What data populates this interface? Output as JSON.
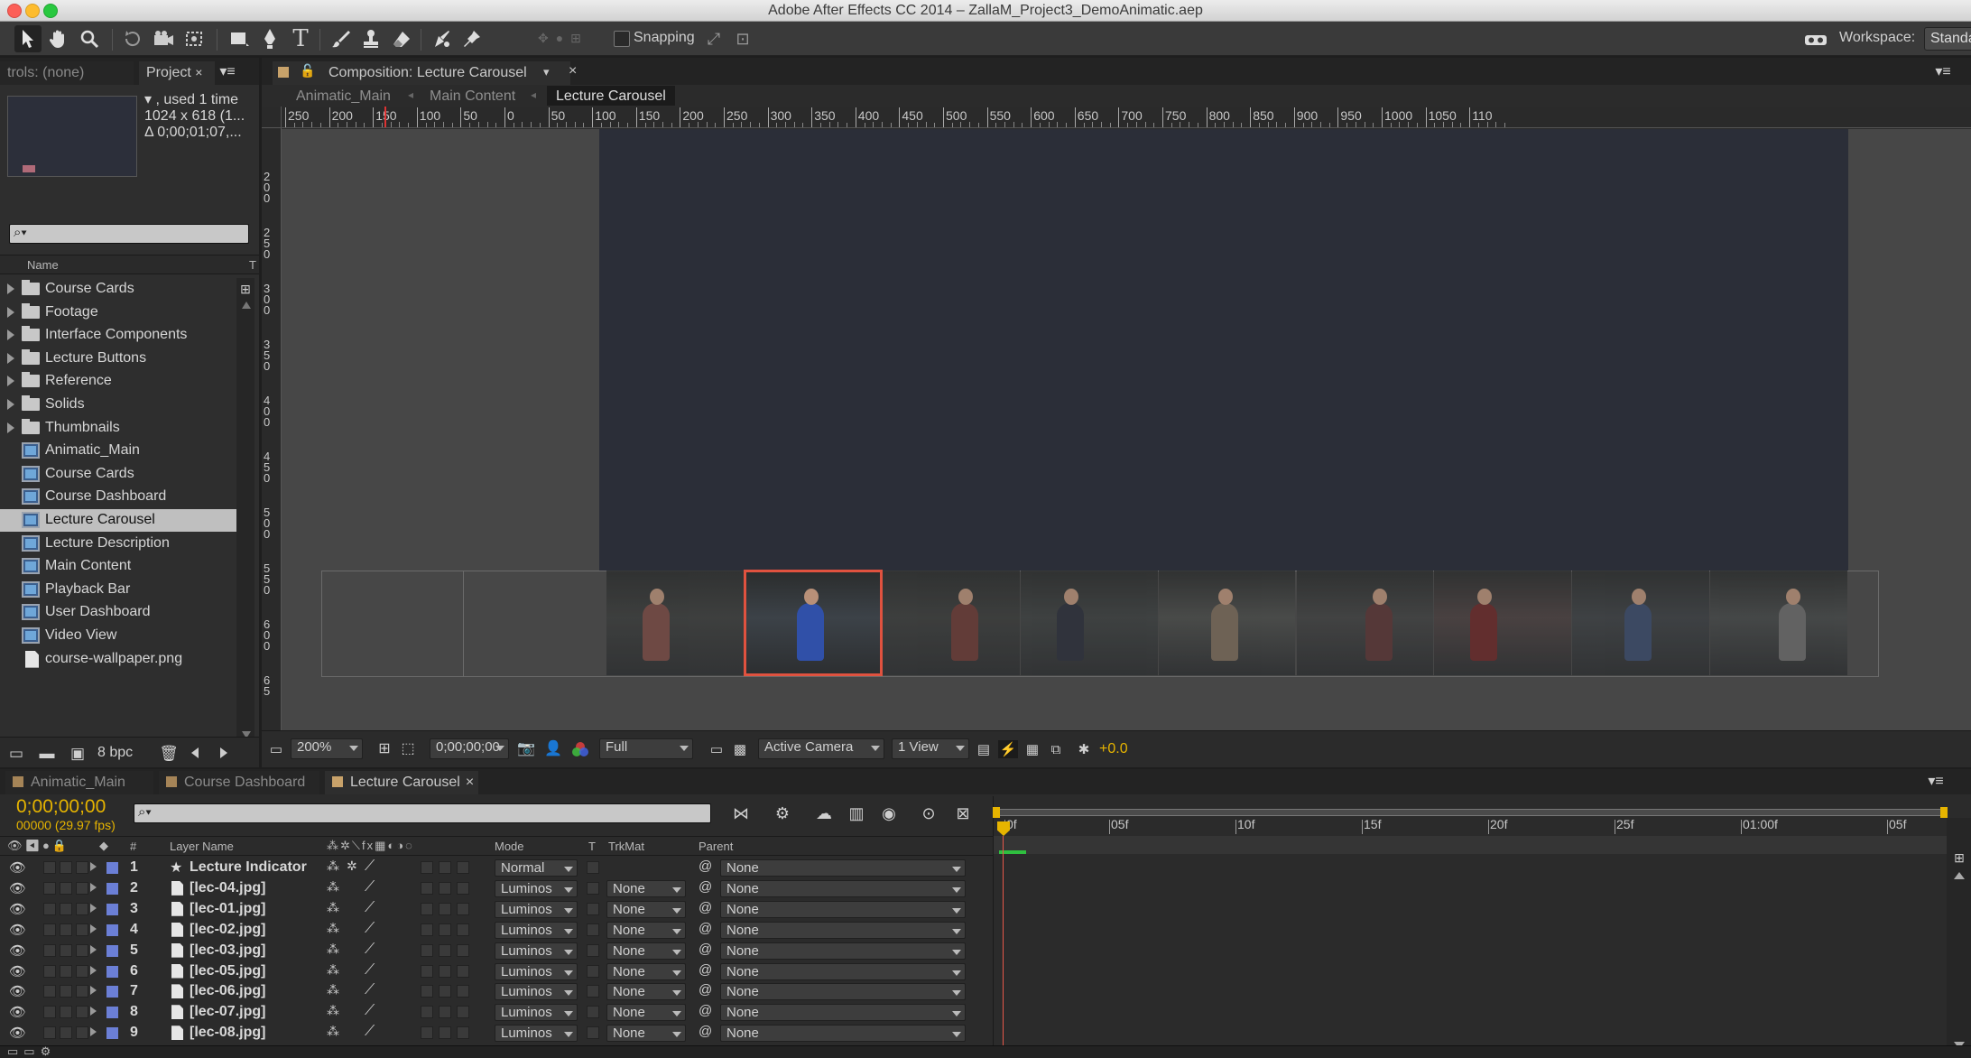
{
  "window": {
    "title": "Adobe After Effects CC 2014 – ZallaM_Project3_DemoAnimatic.aep"
  },
  "toolbar": {
    "snapping_label": "Snapping",
    "workspace_label": "Workspace:",
    "workspace_value": "Standa"
  },
  "left_panel": {
    "effects_tab": "trols: (none)",
    "project_tab": "Project",
    "info_used": "▾ , used 1 time",
    "info_size": "1024 x 618 (1...",
    "info_duration": "Δ 0;00;01;07,...",
    "search_placeholder": "",
    "col_name": "Name",
    "col_type": "T",
    "items": [
      {
        "label": "Course Cards",
        "kind": "folder"
      },
      {
        "label": "Footage",
        "kind": "folder"
      },
      {
        "label": "Interface Components",
        "kind": "folder"
      },
      {
        "label": "Lecture Buttons",
        "kind": "folder"
      },
      {
        "label": "Reference",
        "kind": "folder"
      },
      {
        "label": "Solids",
        "kind": "folder"
      },
      {
        "label": "Thumbnails",
        "kind": "folder"
      },
      {
        "label": "Animatic_Main",
        "kind": "comp"
      },
      {
        "label": "Course Cards",
        "kind": "comp"
      },
      {
        "label": "Course Dashboard",
        "kind": "comp"
      },
      {
        "label": "Lecture Carousel",
        "kind": "comp",
        "selected": true
      },
      {
        "label": "Lecture Description",
        "kind": "comp"
      },
      {
        "label": "Main Content",
        "kind": "comp"
      },
      {
        "label": "Playback Bar",
        "kind": "comp"
      },
      {
        "label": "User Dashboard",
        "kind": "comp"
      },
      {
        "label": "Video View",
        "kind": "comp"
      },
      {
        "label": "course-wallpaper.png",
        "kind": "file"
      }
    ],
    "bpc": "8 bpc"
  },
  "composition": {
    "tab_label": "Composition: Lecture Carousel",
    "breadcrumbs": [
      "Animatic_Main",
      "Main Content",
      "Lecture Carousel"
    ],
    "ruler_h": [
      "250",
      "200",
      "150",
      "100",
      "50",
      "0",
      "50",
      "100",
      "150",
      "200",
      "250",
      "300",
      "350",
      "400",
      "450",
      "500",
      "550",
      "600",
      "650",
      "700",
      "750",
      "800",
      "850",
      "900",
      "950",
      "1000",
      "1050",
      "110"
    ],
    "ruler_v": [
      "2 0 0",
      "2 5 0",
      "3 0 0",
      "3 5 0",
      "4 0 0",
      "4 5 0",
      "5 0 0",
      "5 5 0",
      "6 0 0",
      "6 5"
    ],
    "zoom": "200%",
    "timecode": "0;00;00;00",
    "resolution": "Full",
    "camera": "Active Camera",
    "views": "1 View",
    "exposure": "+0.0"
  },
  "timeline": {
    "tabs": [
      "Animatic_Main",
      "Course Dashboard",
      "Lecture Carousel"
    ],
    "timecode": "0;00;00;00",
    "frames": "00000 (29.97 fps)",
    "col_num": "#",
    "col_layer": "Layer Name",
    "col_mode": "Mode",
    "col_t": "T",
    "col_trkmat": "TrkMat",
    "col_parent": "Parent",
    "time_labels": [
      "0f",
      "05f",
      "10f",
      "15f",
      "20f",
      "25f",
      "01:00f",
      "05f"
    ],
    "layers": [
      {
        "num": "1",
        "name": "Lecture Indicator",
        "kind": "star",
        "mode": "Normal",
        "trkmat": "",
        "parent": "None"
      },
      {
        "num": "2",
        "name": "[lec-04.jpg]",
        "kind": "file",
        "mode": "Luminos",
        "trkmat": "None",
        "parent": "None"
      },
      {
        "num": "3",
        "name": "[lec-01.jpg]",
        "kind": "file",
        "mode": "Luminos",
        "trkmat": "None",
        "parent": "None"
      },
      {
        "num": "4",
        "name": "[lec-02.jpg]",
        "kind": "file",
        "mode": "Luminos",
        "trkmat": "None",
        "parent": "None"
      },
      {
        "num": "5",
        "name": "[lec-03.jpg]",
        "kind": "file",
        "mode": "Luminos",
        "trkmat": "None",
        "parent": "None"
      },
      {
        "num": "6",
        "name": "[lec-05.jpg]",
        "kind": "file",
        "mode": "Luminos",
        "trkmat": "None",
        "parent": "None"
      },
      {
        "num": "7",
        "name": "[lec-06.jpg]",
        "kind": "file",
        "mode": "Luminos",
        "trkmat": "None",
        "parent": "None"
      },
      {
        "num": "8",
        "name": "[lec-07.jpg]",
        "kind": "file",
        "mode": "Luminos",
        "trkmat": "None",
        "parent": "None"
      },
      {
        "num": "9",
        "name": "[lec-08.jpg]",
        "kind": "file",
        "mode": "Luminos",
        "trkmat": "None",
        "parent": "None"
      }
    ]
  },
  "colors": {
    "accent_timecode": "#e6b400",
    "layer_label": "#6b7fd6",
    "selection": "#e0523f",
    "comp_bg": "#2b2e38",
    "track_bar": "#8a8ab6",
    "first_layer_bar": "#3147a8"
  },
  "icons": [
    "selection-tool-icon",
    "hand-tool-icon",
    "zoom-tool-icon",
    "rotate-tool-icon",
    "camera-tool-icon",
    "pan-behind-icon",
    "rectangle-tool-icon",
    "pen-tool-icon",
    "type-tool-icon",
    "brush-tool-icon",
    "clone-stamp-icon",
    "eraser-icon",
    "roto-brush-icon",
    "puppet-pin-icon"
  ]
}
